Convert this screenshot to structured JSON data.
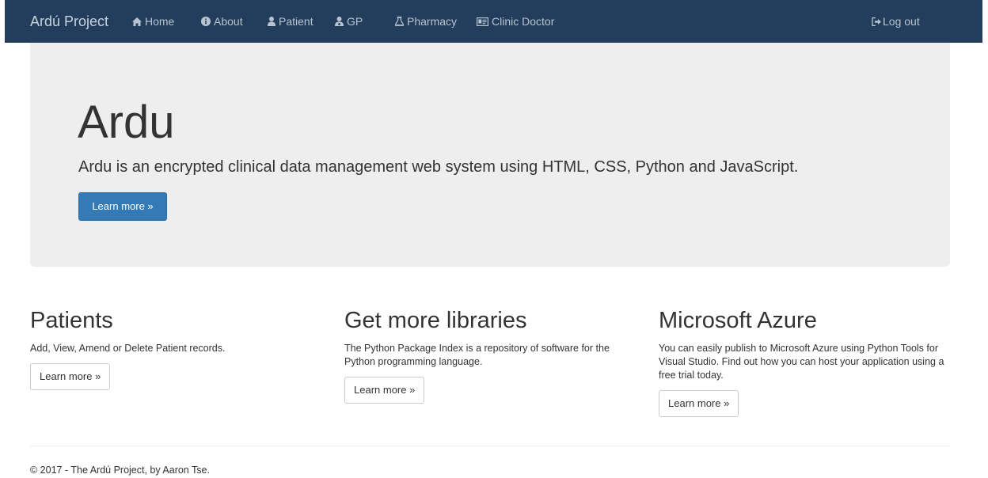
{
  "navbar": {
    "brand": "Ardú Project",
    "items": [
      {
        "label": "Home",
        "icon": "home-icon"
      },
      {
        "label": "About",
        "icon": "info-icon"
      },
      {
        "label": "Patient",
        "icon": "user-icon"
      },
      {
        "label": "GP",
        "icon": "doctor-icon"
      },
      {
        "label": "Pharmacy",
        "icon": "flask-icon"
      },
      {
        "label": "Clinic Doctor",
        "icon": "id-card-icon"
      }
    ],
    "logout": {
      "label": "Log out",
      "icon": "logout-icon"
    }
  },
  "jumbotron": {
    "title": "Ardu",
    "lead": "Ardu is an encrypted clinical data management web system using HTML, CSS, Python and JavaScript.",
    "button": "Learn more »"
  },
  "columns": [
    {
      "title": "Patients",
      "text": "Add, View, Amend or Delete Patient records.",
      "button": "Learn more »"
    },
    {
      "title": "Get more libraries",
      "text": "The Python Package Index is a repository of software for the Python programming language.",
      "button": "Learn more »"
    },
    {
      "title": "Microsoft Azure",
      "text": "You can easily publish to Microsoft Azure using Python Tools for Visual Studio. Find out how you can host your application using a free trial today.",
      "button": "Learn more »"
    }
  ],
  "footer": {
    "text": "© 2017 - The Ardú Project, by Aaron Tse."
  },
  "colors": {
    "navbar_bg": "#223e5c",
    "jumbotron_bg": "#eeeeee",
    "primary": "#337ab7"
  }
}
